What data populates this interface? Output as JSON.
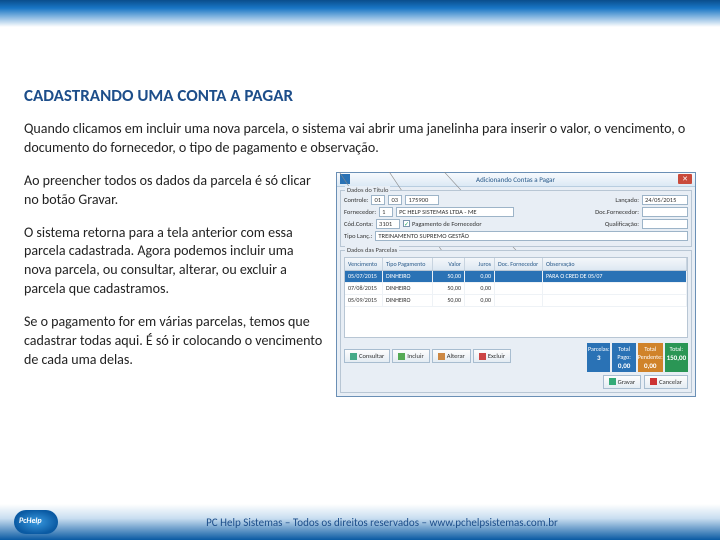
{
  "title": "CADASTRANDO UMA CONTA A PAGAR",
  "intro": "Quando clicamos em incluir uma nova parcela, o sistema vai abrir uma janelinha para inserir o valor, o vencimento, o documento do fornecedor, o tipo de pagamento e observação.",
  "p1": "Ao preencher todos os dados da parcela é só clicar no botão Gravar.",
  "p2": "O sistema retorna para a tela anterior com essa parcela cadastrada. Agora podemos incluir uma nova parcela, ou consultar, alterar, ou excluir a parcela que cadastramos.",
  "p3": "Se o pagamento for em várias parcelas, temos que cadastrar todas aqui. É só ir colocando o vencimento de cada uma delas.",
  "win": {
    "title": "Adicionando Contas a Pagar",
    "grp1": "Dados do Título",
    "controle_lbl": "Controle:",
    "controle_a": "01",
    "controle_b": "03",
    "controle_c": "175900",
    "lanc_lbl": "Lançado:",
    "lanc_val": "24/05/2015",
    "forn_lbl": "Fornecedor:",
    "forn_a": "1",
    "forn_b": "PC HELP SISTEMAS LTDA - ME",
    "docf_lbl": "Doc.Fornecedor:",
    "docf_val": "",
    "codc_lbl": "Cód.Conta:",
    "codc_a": "3101",
    "codc_chk": "Pagamento de Fornecedor",
    "qual_lbl": "Qualificação:",
    "qual_val": "",
    "tipolan_lbl": "Tipo Lanç.:",
    "tipolan_val": "TREINAMENTO SUPREMO GESTÃO",
    "grp2": "Dados das Parcelas",
    "cols": [
      "Vencimento",
      "Tipo Pagamento",
      "Valor",
      "Juros",
      "Doc. Fornecedor",
      "Observação"
    ],
    "rows": [
      {
        "venc": "05/07/2015",
        "tipo": "DINHEIRO",
        "valor": "50,00",
        "juros": "0,00",
        "doc": "",
        "obs": "PARA O CRED DE 05/07"
      },
      {
        "venc": "07/08/2015",
        "tipo": "DINHEIRO",
        "valor": "50,00",
        "juros": "0,00",
        "doc": "",
        "obs": ""
      },
      {
        "venc": "05/09/2015",
        "tipo": "DINHEIRO",
        "valor": "50,00",
        "juros": "0,00",
        "doc": "",
        "obs": ""
      }
    ],
    "btn_consultar": "Consultar",
    "btn_incluir": "Incluir",
    "btn_alterar": "Alterar",
    "btn_excluir": "Excluir",
    "st_parc_lbl": "Parcelas:",
    "st_parc_v": "3",
    "st_pago_lbl": "Total Pago:",
    "st_pago_v": "0,00",
    "st_pend_lbl": "Total Pendente:",
    "st_pend_v": "0,00",
    "st_tot_lbl": "Total:",
    "st_tot_v": "150,00",
    "btn_gravar": "Gravar",
    "btn_cancelar": "Cancelar"
  },
  "footer": "PC Help Sistemas – Todos os direitos reservados – www.pchelpsistemas.com.br"
}
